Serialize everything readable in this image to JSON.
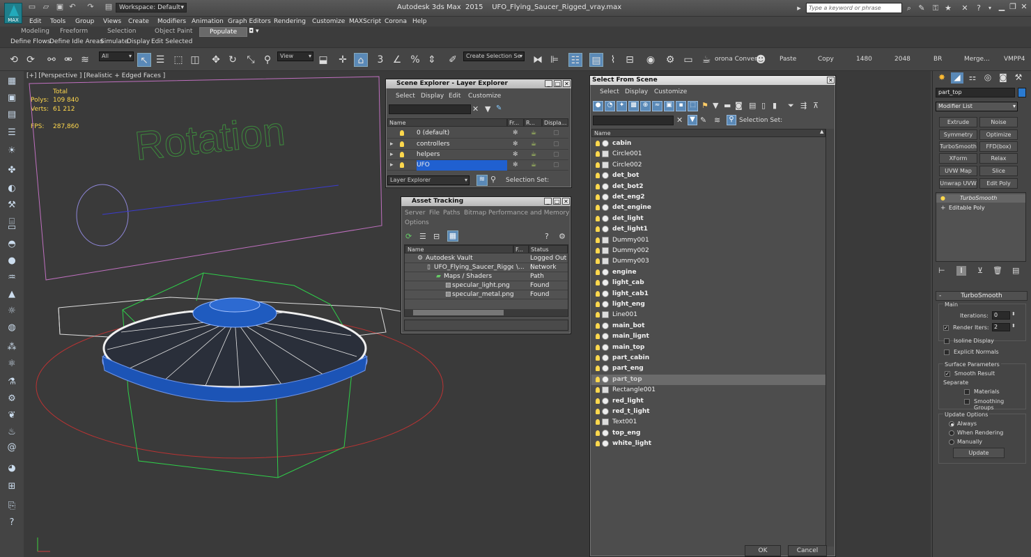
{
  "titlebar": {
    "logo_text": "MAX",
    "workspace": "Workspace: Default",
    "app_title": "Autodesk 3ds Max  2015    UFO_Flying_Saucer_Rigged_vray.max",
    "search_placeholder": "Type a keyword or phrase"
  },
  "menu": [
    "Edit",
    "Tools",
    "Group",
    "Views",
    "Create",
    "Modifiers",
    "Animation",
    "Graph Editors",
    "Rendering",
    "Customize",
    "MAXScript",
    "Corona",
    "Help"
  ],
  "ribbon": {
    "tabs": [
      "Modeling",
      "Freeform",
      "Selection",
      "Object Paint",
      "Populate"
    ],
    "subtabs": [
      "Define Flows",
      "Define Idle Areas",
      "Simulate",
      "Display",
      "Edit Selected"
    ]
  },
  "maintoolbar": {
    "filter": "All",
    "refcoord": "View",
    "selset": "Create Selection Se",
    "corona_convert": "orona Convert",
    "labels": [
      "Paste",
      "Copy",
      "1480",
      "2048",
      "BR",
      "Merge...",
      "VMPP4"
    ]
  },
  "viewport": {
    "label": "[+] [Perspective ] [Realistic + Edged Faces ]",
    "stats_total": "Total",
    "polys_label": "Polys:",
    "polys_value": "109 840",
    "verts_label": "Verts:",
    "verts_value": "61 212",
    "fps_label": "FPS:",
    "fps_value": "287,860",
    "rotation_text": "Rotation"
  },
  "scene_explorer": {
    "title": "Scene Explorer - Layer Explorer",
    "menu": [
      "Select",
      "Display",
      "Edit",
      "Customize"
    ],
    "columns": [
      "Name",
      "Fr...",
      "R...",
      "Displa..."
    ],
    "rows": [
      "0 (default)",
      "controllers",
      "helpers",
      "UFO"
    ],
    "footer_dropdown": "Layer Explorer",
    "footer_selset": "Selection Set:"
  },
  "asset_tracking": {
    "title": "Asset Tracking",
    "menu": [
      "Server",
      "File",
      "Paths",
      "Bitmap Performance and Memory"
    ],
    "menu2": "Options",
    "columns": [
      "Name",
      "F...",
      "Status"
    ],
    "rows": [
      {
        "name": "Autodesk Vault",
        "f": "",
        "status": "Logged Out (..."
      },
      {
        "name": "UFO_Flying_Saucer_Rigged...",
        "f": "\\...",
        "status": "Network Path"
      },
      {
        "name": "Maps / Shaders",
        "f": "",
        "status": ""
      },
      {
        "name": "specular_light.png",
        "f": "",
        "status": "Found"
      },
      {
        "name": "specular_metal.png",
        "f": "",
        "status": "Found"
      }
    ]
  },
  "select_from_scene": {
    "title": "Select From Scene",
    "menu": [
      "Select",
      "Display",
      "Customize"
    ],
    "selset": "Selection Set:",
    "column": "Name",
    "rows": [
      {
        "name": "cabin",
        "bold": true,
        "shape": false
      },
      {
        "name": "Circle001",
        "bold": false,
        "shape": true
      },
      {
        "name": "Circle002",
        "bold": false,
        "shape": true
      },
      {
        "name": "det_bot",
        "bold": true,
        "shape": false
      },
      {
        "name": "det_bot2",
        "bold": true,
        "shape": false
      },
      {
        "name": "det_eng2",
        "bold": true,
        "shape": false
      },
      {
        "name": "det_engine",
        "bold": true,
        "shape": false
      },
      {
        "name": "det_light",
        "bold": true,
        "shape": false
      },
      {
        "name": "det_light1",
        "bold": true,
        "shape": false
      },
      {
        "name": "Dummy001",
        "bold": false,
        "shape": true
      },
      {
        "name": "Dummy002",
        "bold": false,
        "shape": true
      },
      {
        "name": "Dummy003",
        "bold": false,
        "shape": true
      },
      {
        "name": "engine",
        "bold": true,
        "shape": false
      },
      {
        "name": "light_cab",
        "bold": true,
        "shape": false
      },
      {
        "name": "light_cab1",
        "bold": true,
        "shape": false
      },
      {
        "name": "light_eng",
        "bold": true,
        "shape": false
      },
      {
        "name": "Line001",
        "bold": false,
        "shape": true
      },
      {
        "name": "main_bot",
        "bold": true,
        "shape": false
      },
      {
        "name": "main_lignt",
        "bold": true,
        "shape": false
      },
      {
        "name": "main_top",
        "bold": true,
        "shape": false
      },
      {
        "name": "part_cabin",
        "bold": true,
        "shape": false
      },
      {
        "name": "part_eng",
        "bold": true,
        "shape": false
      },
      {
        "name": "part_top",
        "bold": true,
        "shape": false,
        "selected": true
      },
      {
        "name": "Rectangle001",
        "bold": false,
        "shape": true
      },
      {
        "name": "red_light",
        "bold": true,
        "shape": false
      },
      {
        "name": "red_t_light",
        "bold": true,
        "shape": false
      },
      {
        "name": "Text001",
        "bold": false,
        "shape": true
      },
      {
        "name": "top_eng",
        "bold": true,
        "shape": false
      },
      {
        "name": "white_light",
        "bold": true,
        "shape": false
      }
    ],
    "ok": "OK",
    "cancel": "Cancel"
  },
  "command_panel": {
    "object_name": "part_top",
    "modifier_list": "Modifier List",
    "buttons": [
      "Extrude",
      "Noise",
      "Symmetry",
      "Optimize",
      "TurboSmooth",
      "FFD(box)",
      "XForm",
      "Relax",
      "UVW Map",
      "Slice",
      "Unwrap UVW",
      "Edit Poly"
    ],
    "stack": [
      "TurboSmooth",
      "Editable Poly"
    ],
    "rollout_title": "TurboSmooth",
    "main_label": "Main",
    "iterations_label": "Iterations:",
    "iterations_value": "0",
    "render_iters_label": "Render Iters:",
    "render_iters_value": "2",
    "isoline": "Isoline Display",
    "explicit": "Explicit Normals",
    "surface_params": "Surface Parameters",
    "smooth_result": "Smooth Result",
    "separate": "Separate",
    "materials": "Materials",
    "smoothing_groups": "Smoothing Groups",
    "update_options": "Update Options",
    "always": "Always",
    "when_rendering": "When Rendering",
    "manually": "Manually",
    "update": "Update"
  },
  "colors": {
    "selection_blue": "#2060d0",
    "wire_green": "#00ff3c",
    "bulb_yellow": "#ffd84d",
    "ufo_blue": "#1b4fa8"
  }
}
